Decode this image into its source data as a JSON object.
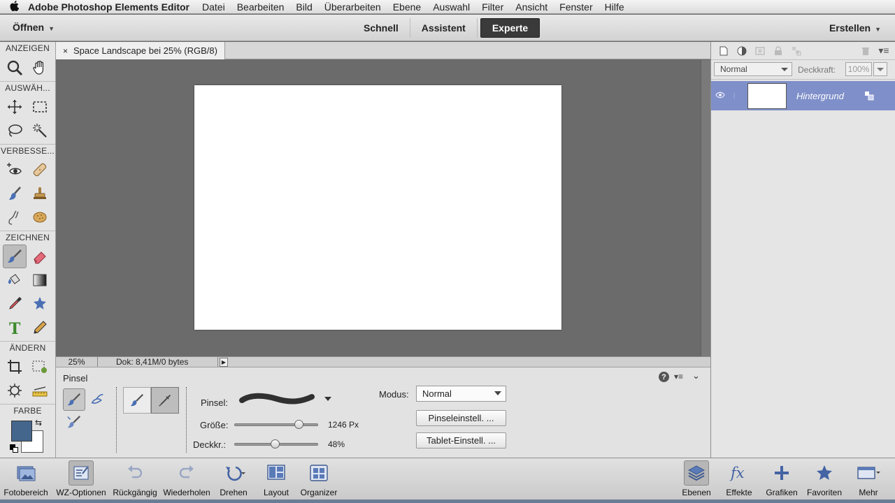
{
  "menubar": {
    "apple_icon": "apple-icon",
    "app_name": "Adobe Photoshop Elements Editor",
    "menus": [
      "Datei",
      "Bearbeiten",
      "Bild",
      "Überarbeiten",
      "Ebene",
      "Auswahl",
      "Filter",
      "Ansicht",
      "Fenster",
      "Hilfe"
    ]
  },
  "modebar": {
    "open_label": "Öffnen",
    "tabs": [
      {
        "label": "Schnell",
        "active": false
      },
      {
        "label": "Assistent",
        "active": false
      },
      {
        "label": "Experte",
        "active": true
      }
    ],
    "create_label": "Erstellen"
  },
  "toolbox": {
    "sections": {
      "view": "ANZEIGEN",
      "select": "AUSWÄH...",
      "enhance": "VERBESSE...",
      "draw": "ZEICHNEN",
      "modify": "ÄNDERN",
      "color": "FARBE"
    },
    "colors": {
      "foreground": "#44668c",
      "background": "#ffffff"
    }
  },
  "document": {
    "tab_title": "Space Landscape bei 25% (RGB/8)",
    "zoom": "25%",
    "info": "Dok: 8,41M/0 bytes"
  },
  "tool_options": {
    "title": "Pinsel",
    "brush_label": "Pinsel:",
    "size_label": "Größe:",
    "size_value": "1246 Px",
    "size_fraction": 0.77,
    "opacity_label": "Deckkr.:",
    "opacity_value": "48%",
    "opacity_fraction": 0.48,
    "mode_label": "Modus:",
    "mode_value": "Normal",
    "brush_settings_btn": "Pinseleinstell. ...",
    "tablet_settings_btn": "Tablet-Einstell. ..."
  },
  "layers": {
    "blend_mode": "Normal",
    "opacity_label": "Deckkraft:",
    "opacity_value": "100%",
    "layer_name": "Hintergrund"
  },
  "taskbar": {
    "left": [
      {
        "label": "Fotobereich",
        "icon": "photo-bin-icon"
      },
      {
        "label": "WZ-Optionen",
        "icon": "tool-options-icon"
      },
      {
        "label": "Rückgängig",
        "icon": "undo-icon"
      },
      {
        "label": "Wiederholen",
        "icon": "redo-icon"
      },
      {
        "label": "Drehen",
        "icon": "rotate-icon"
      },
      {
        "label": "Layout",
        "icon": "layout-icon"
      },
      {
        "label": "Organizer",
        "icon": "organizer-icon"
      }
    ],
    "right": [
      {
        "label": "Ebenen",
        "icon": "layers-icon"
      },
      {
        "label": "Effekte",
        "icon": "effects-icon"
      },
      {
        "label": "Grafiken",
        "icon": "graphics-icon"
      },
      {
        "label": "Favoriten",
        "icon": "favorites-icon"
      },
      {
        "label": "Mehr",
        "icon": "more-icon"
      }
    ]
  }
}
